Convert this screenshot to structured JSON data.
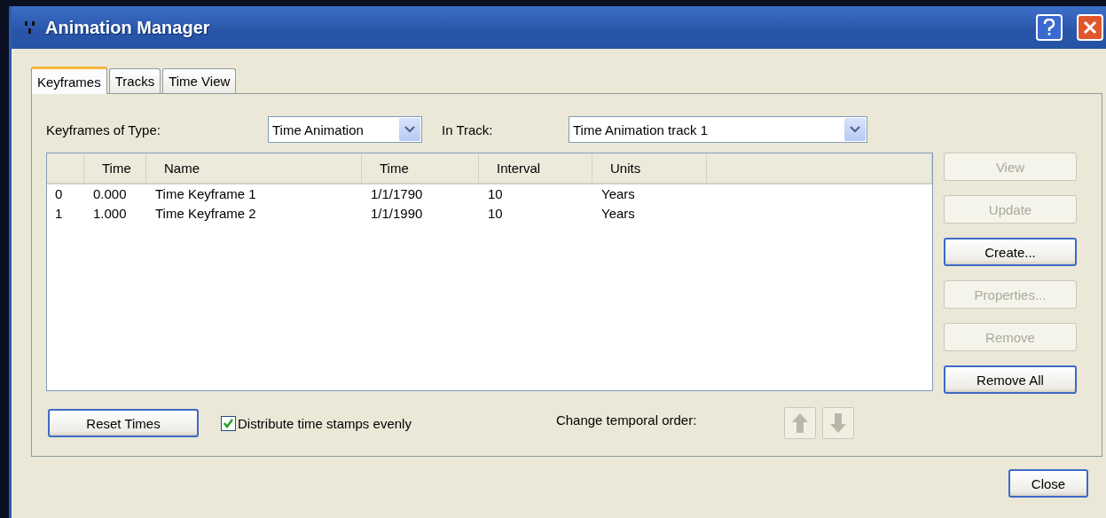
{
  "window": {
    "title": "Animation Manager"
  },
  "tabs": [
    {
      "label": "Keyframes",
      "selected": true
    },
    {
      "label": "Tracks",
      "selected": false
    },
    {
      "label": "Time View",
      "selected": false
    }
  ],
  "filters": [
    {
      "label": "Keyframes of Type:",
      "value": "Time Animation"
    },
    {
      "label": "In Track:",
      "value": "Time Animation track 1"
    }
  ],
  "table": {
    "columns": [
      "",
      "Time",
      "Name",
      "Time",
      "Interval",
      "Units",
      ""
    ],
    "rows": [
      [
        "0",
        "0.000",
        "Time Keyframe 1",
        "1/1/1790",
        "10",
        "Years"
      ],
      [
        "1",
        "1.000",
        "Time Keyframe 2",
        "1/1/1990",
        "10",
        "Years"
      ]
    ]
  },
  "side_buttons": [
    {
      "label": "View",
      "disabled": true
    },
    {
      "label": "Update",
      "disabled": true
    },
    {
      "label": "Create...",
      "disabled": false
    },
    {
      "label": "Properties...",
      "disabled": true
    },
    {
      "label": "Remove",
      "disabled": true
    },
    {
      "label": "Remove All",
      "disabled": false
    }
  ],
  "reset_button": "Reset Times",
  "distribute": {
    "label": "Distribute time stamps evenly",
    "checked": true
  },
  "order": {
    "label": "Change temporal order:",
    "up_disabled": true,
    "down_disabled": true
  },
  "close_button": "Close"
}
